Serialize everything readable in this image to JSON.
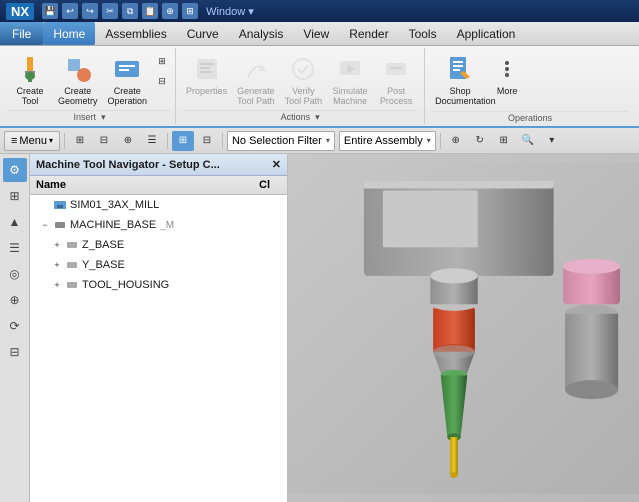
{
  "titlebar": {
    "logo": "NX",
    "window_label": "Window ▾"
  },
  "menubar": {
    "items": [
      {
        "label": "File",
        "active": true
      },
      {
        "label": "Home",
        "active": false
      },
      {
        "label": "Assemblies",
        "active": false
      },
      {
        "label": "Curve",
        "active": false
      },
      {
        "label": "Analysis",
        "active": false
      },
      {
        "label": "View",
        "active": false
      },
      {
        "label": "Render",
        "active": false
      },
      {
        "label": "Tools",
        "active": false
      },
      {
        "label": "Application",
        "active": false
      }
    ]
  },
  "ribbon": {
    "groups": [
      {
        "id": "create",
        "buttons": [
          {
            "label": "Create\nTool",
            "icon": "create-tool-icon",
            "disabled": false
          },
          {
            "label": "Create\nGeometry",
            "icon": "create-geometry-icon",
            "disabled": false
          },
          {
            "label": "Create\nOperation",
            "icon": "create-operation-icon",
            "disabled": false
          }
        ],
        "extra_icons": [
          "icon1",
          "icon2"
        ],
        "group_label": "Insert ▾"
      },
      {
        "id": "actions",
        "buttons": [
          {
            "label": "Properties",
            "icon": "properties-icon",
            "disabled": true
          },
          {
            "label": "Generate\nTool Path",
            "icon": "generate-icon",
            "disabled": true
          },
          {
            "label": "Verify\nTool Path",
            "icon": "verify-icon",
            "disabled": true
          },
          {
            "label": "Simulate\nMachine",
            "icon": "simulate-icon",
            "disabled": true
          },
          {
            "label": "Post\nProcess",
            "icon": "post-icon",
            "disabled": true
          }
        ],
        "group_label": "Actions ▾"
      },
      {
        "id": "operations",
        "buttons": [
          {
            "label": "Shop\nDocumentation",
            "icon": "shop-doc-icon",
            "disabled": false
          },
          {
            "label": "More",
            "icon": "more-icon",
            "disabled": false
          }
        ],
        "group_label": "Operations"
      }
    ]
  },
  "toolbar": {
    "menu_btn": "≡ Menu ▾",
    "filter_label": "No Selection Filter",
    "assembly_label": "Entire Assembly"
  },
  "navigator": {
    "title": "Machine Tool Navigator - Setup C...",
    "columns": [
      {
        "label": "Name"
      },
      {
        "label": "Cl"
      }
    ],
    "tree": [
      {
        "label": "SIM01_3AX_MILL",
        "level": 0,
        "expander": null,
        "icon": "machine-icon"
      },
      {
        "label": "MACHINE_BASE",
        "level": 0,
        "expander": "−",
        "icon": "base-icon",
        "suffix": "_M"
      },
      {
        "label": "Z_BASE",
        "level": 1,
        "expander": "+",
        "icon": "base-icon"
      },
      {
        "label": "Y_BASE",
        "level": 1,
        "expander": "+",
        "icon": "base-icon"
      },
      {
        "label": "TOOL_HOUSING",
        "level": 1,
        "expander": "+",
        "icon": "base-icon"
      }
    ]
  },
  "sidebar": {
    "icons": [
      {
        "name": "settings-icon",
        "symbol": "⚙"
      },
      {
        "name": "nav-icon",
        "symbol": "⊞"
      },
      {
        "name": "arrow-icon",
        "symbol": "↑"
      },
      {
        "name": "layers-icon",
        "symbol": "☰"
      },
      {
        "name": "view-icon",
        "symbol": "◎"
      },
      {
        "name": "measure-icon",
        "symbol": "⊕"
      },
      {
        "name": "history-icon",
        "symbol": "⟳"
      },
      {
        "name": "grid-icon",
        "symbol": "⊟"
      }
    ]
  },
  "colors": {
    "accent": "#5b9bd5",
    "title_bg": "#1a3a6e",
    "active_menu": "#5b9bd5"
  }
}
